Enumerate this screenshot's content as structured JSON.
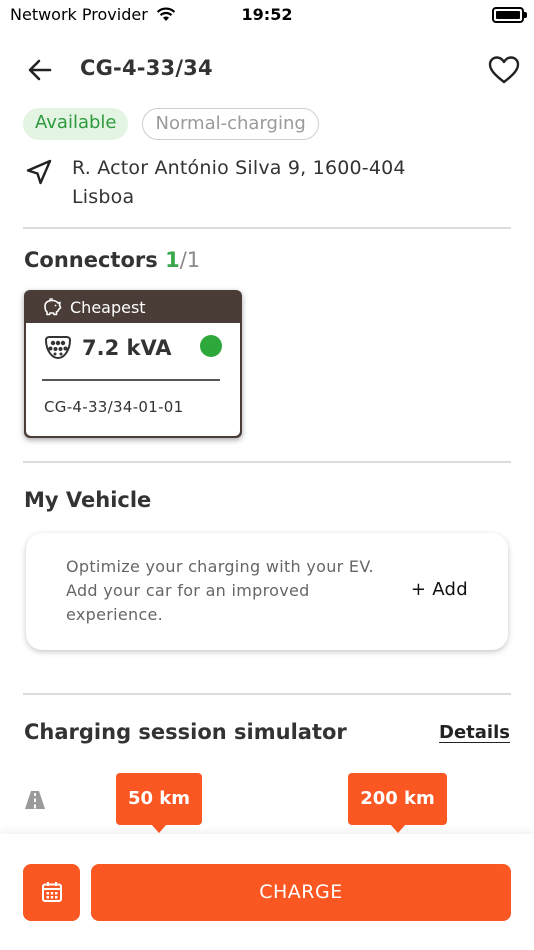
{
  "status_bar": {
    "carrier": "Network Provider",
    "time": "19:52"
  },
  "header": {
    "title": "CG-4-33/34"
  },
  "badges": {
    "availability": "Available",
    "charging_type": "Normal-charging"
  },
  "address": {
    "line1": "R. Actor António Silva 9, 1600-404",
    "line2": "Lisboa"
  },
  "connectors": {
    "title": "Connectors",
    "available": "1",
    "total": "/1",
    "items": [
      {
        "ribbon": "Cheapest",
        "power": "7.2 kVA",
        "id": "CG-4-33/34-01-01",
        "status_color": "#2ea83a"
      }
    ]
  },
  "vehicle": {
    "title": "My Vehicle",
    "description": "Optimize your charging with your EV. Add your car for an improved experience.",
    "add_label": "+ Add"
  },
  "simulator": {
    "title": "Charging session simulator",
    "details_label": "Details",
    "ranges": [
      "50 km",
      "200 km"
    ]
  },
  "actions": {
    "charge_label": "CHARGE"
  },
  "colors": {
    "accent": "#fb5722",
    "available_green": "#3aa74a",
    "ribbon": "#4a3d38"
  }
}
